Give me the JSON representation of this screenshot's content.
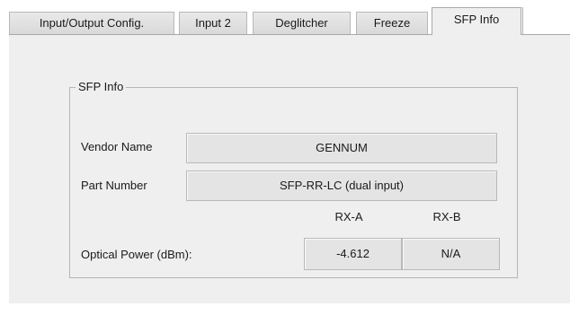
{
  "tabs": [
    {
      "label": "Input/Output Config.",
      "active": false
    },
    {
      "label": "Input 2",
      "active": false
    },
    {
      "label": "Deglitcher",
      "active": false
    },
    {
      "label": "Freeze",
      "active": false
    },
    {
      "label": "SFP Info",
      "active": true
    }
  ],
  "sfp_info": {
    "group_title": "SFP Info",
    "vendor_name_label": "Vendor Name",
    "vendor_name_value": "GENNUM",
    "part_number_label": "Part Number",
    "part_number_value": "SFP-RR-LC (dual input)",
    "rx_a_header": "RX-A",
    "rx_b_header": "RX-B",
    "optical_power_label": "Optical Power (dBm):",
    "rx_a_value": "-4.612",
    "rx_b_value": "N/A"
  }
}
